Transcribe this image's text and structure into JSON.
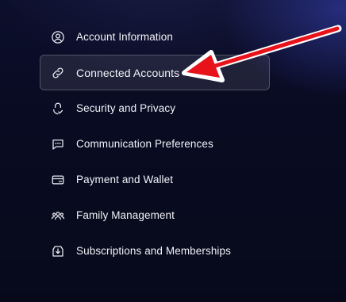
{
  "menu": {
    "items": [
      {
        "label": "Account Information",
        "icon": "user-circle-icon",
        "active": false
      },
      {
        "label": "Connected Accounts",
        "icon": "link-icon",
        "active": true
      },
      {
        "label": "Security and Privacy",
        "icon": "shield-check-icon",
        "active": false
      },
      {
        "label": "Communication Preferences",
        "icon": "chat-icon",
        "active": false
      },
      {
        "label": "Payment and Wallet",
        "icon": "credit-card-icon",
        "active": false
      },
      {
        "label": "Family Management",
        "icon": "users-icon",
        "active": false
      },
      {
        "label": "Subscriptions and Memberships",
        "icon": "download-tray-icon",
        "active": false
      }
    ]
  },
  "colors": {
    "background": "#090b22",
    "text": "#f2f3f8",
    "active_bg": "#1e2033",
    "annotation_arrow": "#e8121b"
  }
}
